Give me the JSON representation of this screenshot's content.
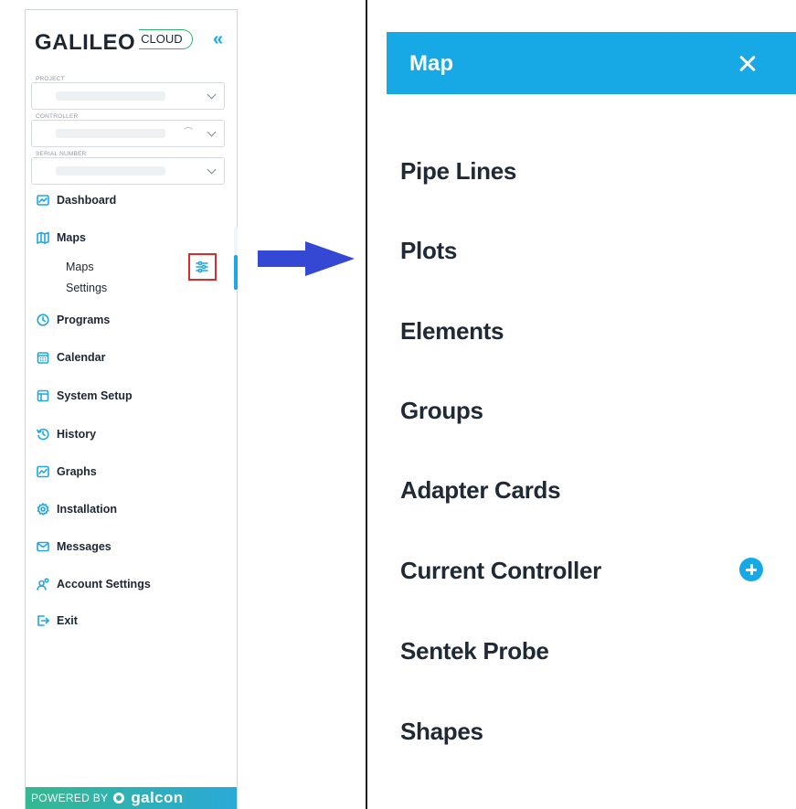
{
  "sidebar": {
    "brand": {
      "name": "GALILEO",
      "suffix": "CLOUD"
    },
    "collapse_label": "«",
    "fields": {
      "project_label": "PROJECT",
      "controller_label": "CONTROLLER",
      "serial_label": "SERIAL NUMBER"
    },
    "nav": {
      "dashboard": "Dashboard",
      "maps": "Maps",
      "maps_sub": [
        "Maps",
        "Settings"
      ],
      "programs": "Programs",
      "calendar": "Calendar",
      "system_setup": "System Setup",
      "history": "History",
      "graphs": "Graphs",
      "installation": "Installation",
      "messages": "Messages",
      "account_settings": "Account Settings",
      "exit": "Exit"
    },
    "footer": {
      "label": "POWERED BY",
      "brand": "galcon"
    }
  },
  "map_panel": {
    "title": "Map",
    "items": [
      "Pipe Lines",
      "Plots",
      "Elements",
      "Groups",
      "Adapter Cards",
      "Current Controller",
      "Sentek Probe",
      "Shapes"
    ]
  },
  "colors": {
    "accent": "#17a9e6",
    "highlight": "#d92c2c",
    "arrow": "#3548d4",
    "brand_green": "#2fb26c"
  },
  "icons": [
    "dashboard-icon",
    "map-icon",
    "filter-icon",
    "clock-icon",
    "calendar-icon",
    "system-setup-icon",
    "history-icon",
    "graph-icon",
    "gear-icon",
    "mail-icon",
    "account-icon",
    "exit-icon",
    "close-icon",
    "plus-circle-icon"
  ]
}
